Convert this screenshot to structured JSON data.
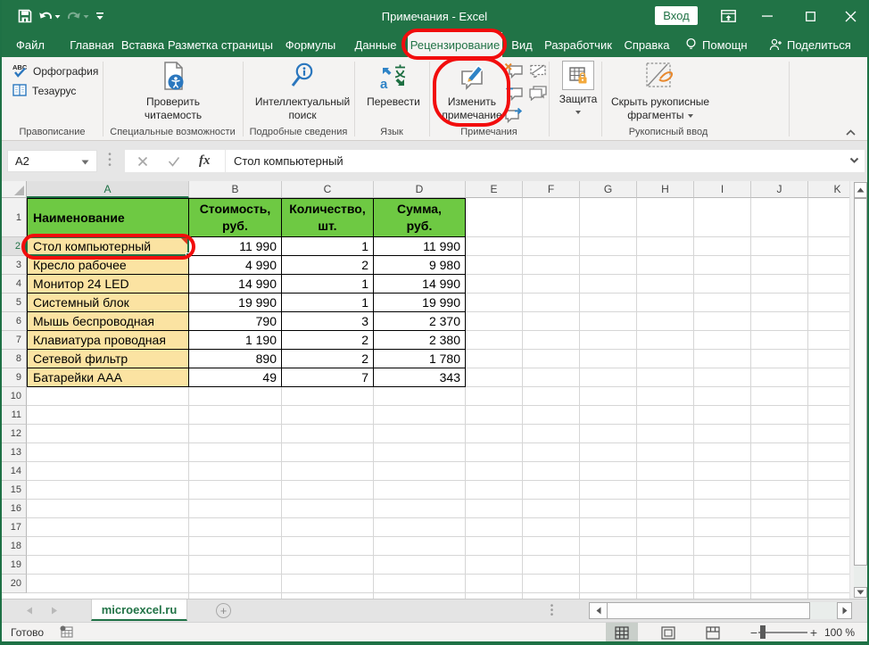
{
  "window": {
    "title": "Примечания - Excel",
    "sign_in_label": "Вход",
    "qat_icons": [
      "save-icon",
      "undo-icon",
      "redo-icon",
      "customize-quick-access-icon"
    ],
    "controls": [
      "ribbon-display-options-icon",
      "minimize-icon",
      "maximize-icon",
      "close-icon"
    ]
  },
  "tabs": {
    "items": [
      "Файл",
      "Главная",
      "Вставка",
      "Разметка страницы",
      "Формулы",
      "Данные",
      "Рецензирование",
      "Вид",
      "Разработчик",
      "Справка"
    ],
    "active": "Рецензирование",
    "helper_label": "Помощн",
    "share_label": "Поделиться"
  },
  "ribbon": {
    "groups": {
      "proofing": {
        "label": "Правописание",
        "buttons": [
          "Орфография",
          "Тезаурус"
        ]
      },
      "accessibility": {
        "label": "Специальные возможности",
        "button": "Проверить\nчитаемость"
      },
      "insights": {
        "label": "Подробные сведения",
        "button": "Интеллектуальный\nпоиск"
      },
      "language": {
        "label": "Язык",
        "button": "Перевести"
      },
      "comments": {
        "label": "Примечания",
        "button": "Изменить\nпримечание",
        "small_buttons": [
          "delete-comment-icon",
          "previous-comment-icon",
          "next-comment-icon",
          "show-hide-comment-icon",
          "show-all-comments-icon"
        ]
      },
      "protect": {
        "label": "Защита"
      },
      "ink": {
        "label": "Рукописный ввод",
        "button": "Скрыть рукописные\nфрагменты"
      }
    }
  },
  "formula_bar": {
    "name_box": "A2",
    "fx_label": "fx",
    "content": "Стол компьютерный"
  },
  "sheet": {
    "column_letters": [
      "A",
      "B",
      "C",
      "D",
      "E",
      "F",
      "G",
      "H",
      "I",
      "J",
      "K"
    ],
    "row_count": 20,
    "selected_column": "A",
    "selected_row": 2,
    "table": {
      "headers": [
        "Наименование",
        "Стоимость,\nруб.",
        "Количество,\nшт.",
        "Сумма,\nруб."
      ],
      "rows": [
        [
          "Стол компьютерный",
          "11 990",
          "1",
          "11 990"
        ],
        [
          "Кресло рабочее",
          "4 990",
          "2",
          "9 980"
        ],
        [
          "Монитор 24 LED",
          "14 990",
          "1",
          "14 990"
        ],
        [
          "Системный блок",
          "19 990",
          "1",
          "19 990"
        ],
        [
          "Мышь беспроводная",
          "790",
          "3",
          "2 370"
        ],
        [
          "Клавиатура проводная",
          "1 190",
          "2",
          "2 380"
        ],
        [
          "Сетевой фильтр",
          "890",
          "2",
          "1 780"
        ],
        [
          "Батарейки AAA",
          "49",
          "7",
          "343"
        ]
      ]
    }
  },
  "sheet_tabs": {
    "active": "microexcel.ru"
  },
  "status_bar": {
    "ready": "Готово",
    "zoom": "100 %"
  },
  "colors": {
    "brand_green": "#217346",
    "table_header_green": "#6EC943",
    "name_column_fill": "#FBE3A2",
    "annotation_red": "#F20D0D"
  }
}
